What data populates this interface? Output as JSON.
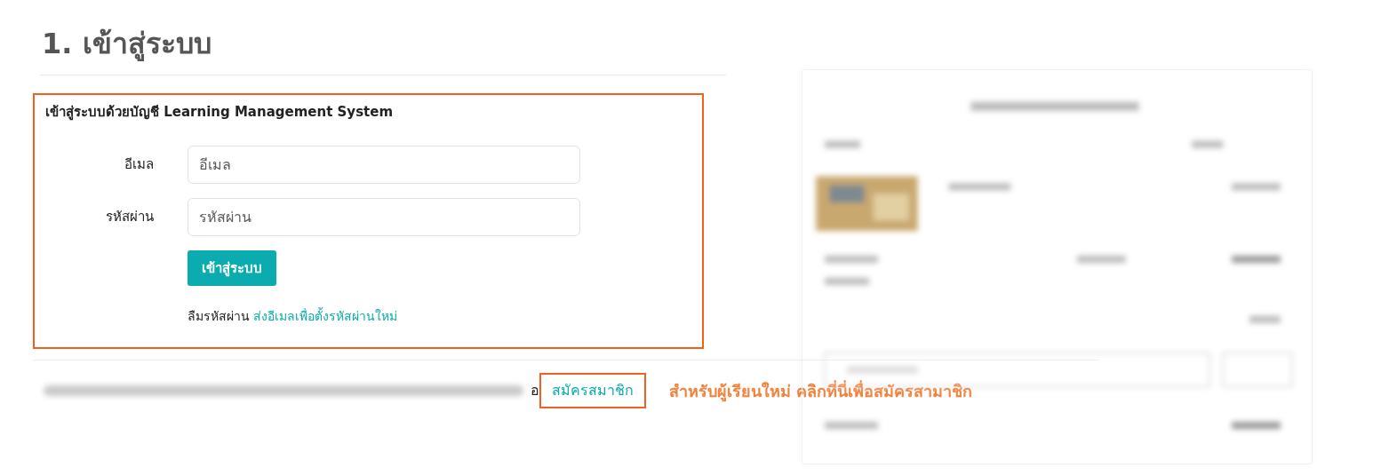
{
  "heading": "1. เข้าสู่ระบบ",
  "login_form": {
    "highlighted": true,
    "title": "เข้าสู่ระบบด้วยบัญชี Learning Management System",
    "fields": [
      {
        "label": "อีเมล",
        "placeholder": "อีเมล"
      },
      {
        "label": "รหัสผ่าน",
        "placeholder": "รหัสผ่าน"
      }
    ],
    "button": "เข้าสู่ระบบ",
    "forgot": {
      "text": "ลืมรหัสผ่าน",
      "link": "ส่งอีเมลเพื่อตั้งรหัสผ่านใหม่"
    }
  },
  "register": {
    "fragment": "อ",
    "link": "สมัครสมาชิก",
    "highlighted": true
  },
  "annotation": "สำหรับผู้เรียนใหม่ คลิกที่นี่เพื่อสมัครสามาชิก"
}
